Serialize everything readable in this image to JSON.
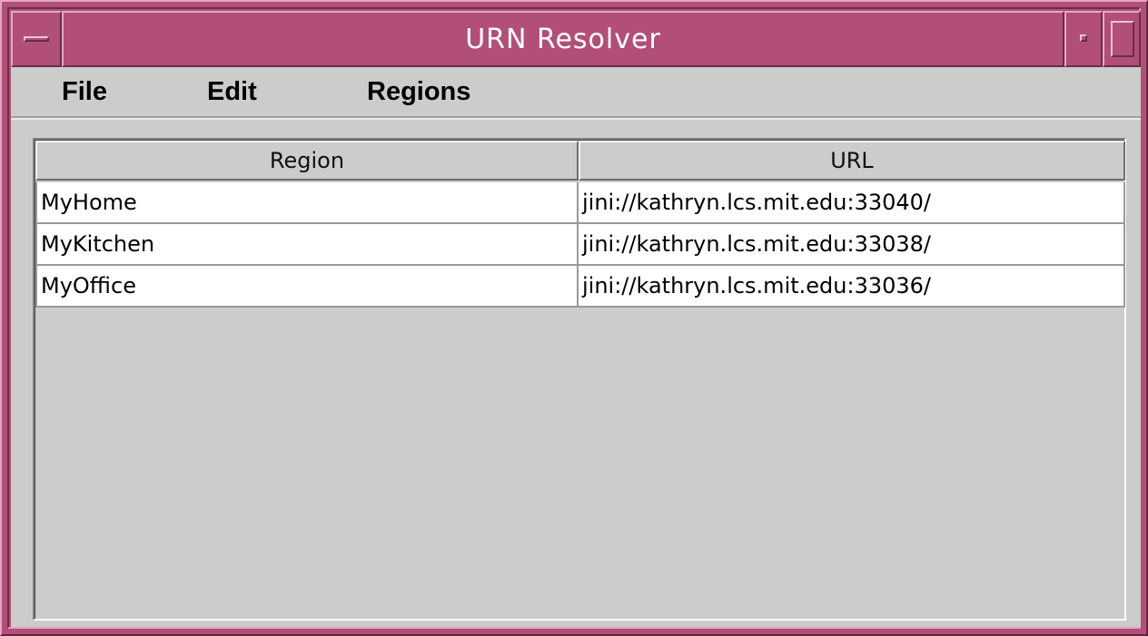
{
  "window": {
    "title": "URN Resolver"
  },
  "menubar": {
    "items": [
      {
        "label": "File"
      },
      {
        "label": "Edit"
      },
      {
        "label": "Regions"
      }
    ]
  },
  "table": {
    "columns": [
      "Region",
      "URL"
    ],
    "rows": [
      {
        "region": "MyHome",
        "url": "jini://kathryn.lcs.mit.edu:33040/"
      },
      {
        "region": "MyKitchen",
        "url": "jini://kathryn.lcs.mit.edu:33038/"
      },
      {
        "region": "MyOffice",
        "url": "jini://kathryn.lcs.mit.edu:33036/"
      }
    ]
  },
  "colors": {
    "titlebar": "#b14f78",
    "background": "#cccccc",
    "cell_background": "#ffffff"
  },
  "icons": {
    "window_menu": "window-menu-icon",
    "minimize": "minimize-icon",
    "maximize": "maximize-icon"
  }
}
